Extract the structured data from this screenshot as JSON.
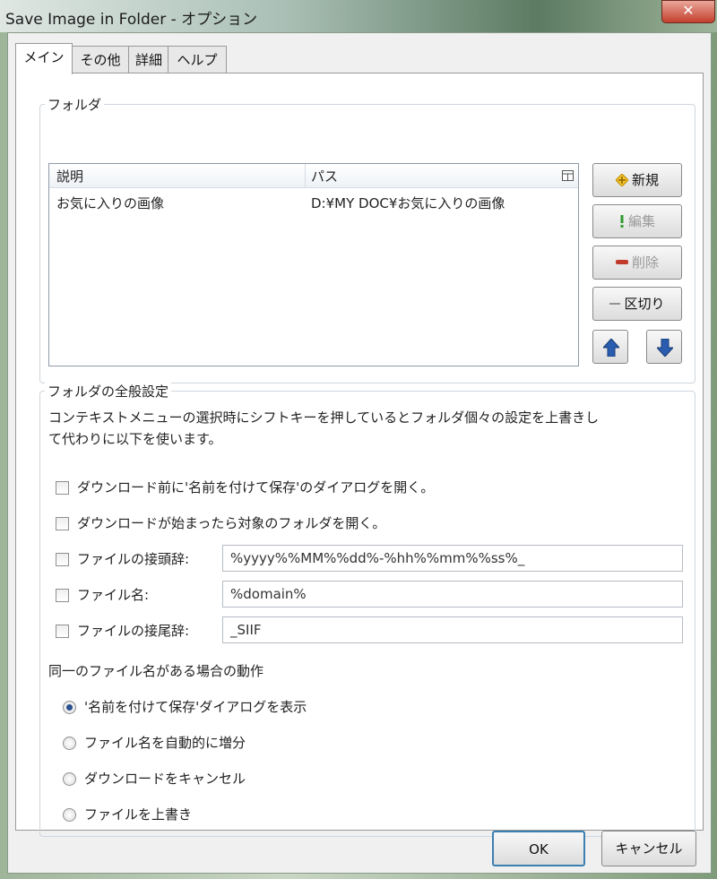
{
  "window": {
    "title": "Save Image in Folder - オプション",
    "close_label": "✕"
  },
  "tabs": [
    {
      "label": "メイン",
      "active": true
    },
    {
      "label": "その他",
      "active": false
    },
    {
      "label": "詳細",
      "active": false
    },
    {
      "label": "ヘルプ",
      "active": false
    }
  ],
  "folder_group": {
    "label": "フォルダ",
    "columns": {
      "description": "説明",
      "path": "パス"
    },
    "column_chooser_icon": "column-chooser-icon",
    "rows": [
      {
        "description": "お気に入りの画像",
        "path": "D:¥MY DOC¥お気に入りの画像"
      }
    ],
    "buttons": {
      "new": "新規",
      "edit": "編集",
      "delete": "削除",
      "separator": "区切り"
    },
    "new_icon": "diamond-plus-icon",
    "edit_icon": "exclamation-icon",
    "delete_icon": "minus-icon",
    "separator_icon": "dash-icon",
    "move_up_icon": "arrow-up-icon",
    "move_down_icon": "arrow-down-icon"
  },
  "global_group": {
    "label": "フォルダの全般設定",
    "description_line1": "コンテキストメニューの選択時にシフトキーを押しているとフォルダ個々の設定を上書きし",
    "description_line2": "て代わりに以下を使います。",
    "options": [
      {
        "label": "ダウンロード前に'名前を付けて保存'のダイアログを開く。",
        "checked": false
      },
      {
        "label": "ダウンロードが始まったら対象のフォルダを開く。",
        "checked": false
      }
    ],
    "prefix": {
      "label": "ファイルの接頭辞:",
      "value": "%yyyy%%MM%%dd%-%hh%%mm%%ss%_",
      "checked": false
    },
    "filename": {
      "label": "ファイル名:",
      "value": "%domain%",
      "checked": false
    },
    "suffix": {
      "label": "ファイルの接尾辞:",
      "value": "_SIIF",
      "checked": false
    }
  },
  "duplicate": {
    "heading": "同一のファイル名がある場合の動作",
    "options": [
      {
        "label": "'名前を付けて保存'ダイアログを表示",
        "checked": true
      },
      {
        "label": "ファイル名を自動的に増分",
        "checked": false
      },
      {
        "label": "ダウンロードをキャンセル",
        "checked": false
      },
      {
        "label": "ファイルを上書き",
        "checked": false
      }
    ]
  },
  "footer": {
    "ok": "OK",
    "cancel": "キャンセル"
  },
  "colors": {
    "accent": "#2a4f8f",
    "icon_yellow": "#e0a800",
    "icon_green": "#2e9a2e",
    "icon_red": "#c0392b",
    "icon_blue": "#2a5db0"
  }
}
